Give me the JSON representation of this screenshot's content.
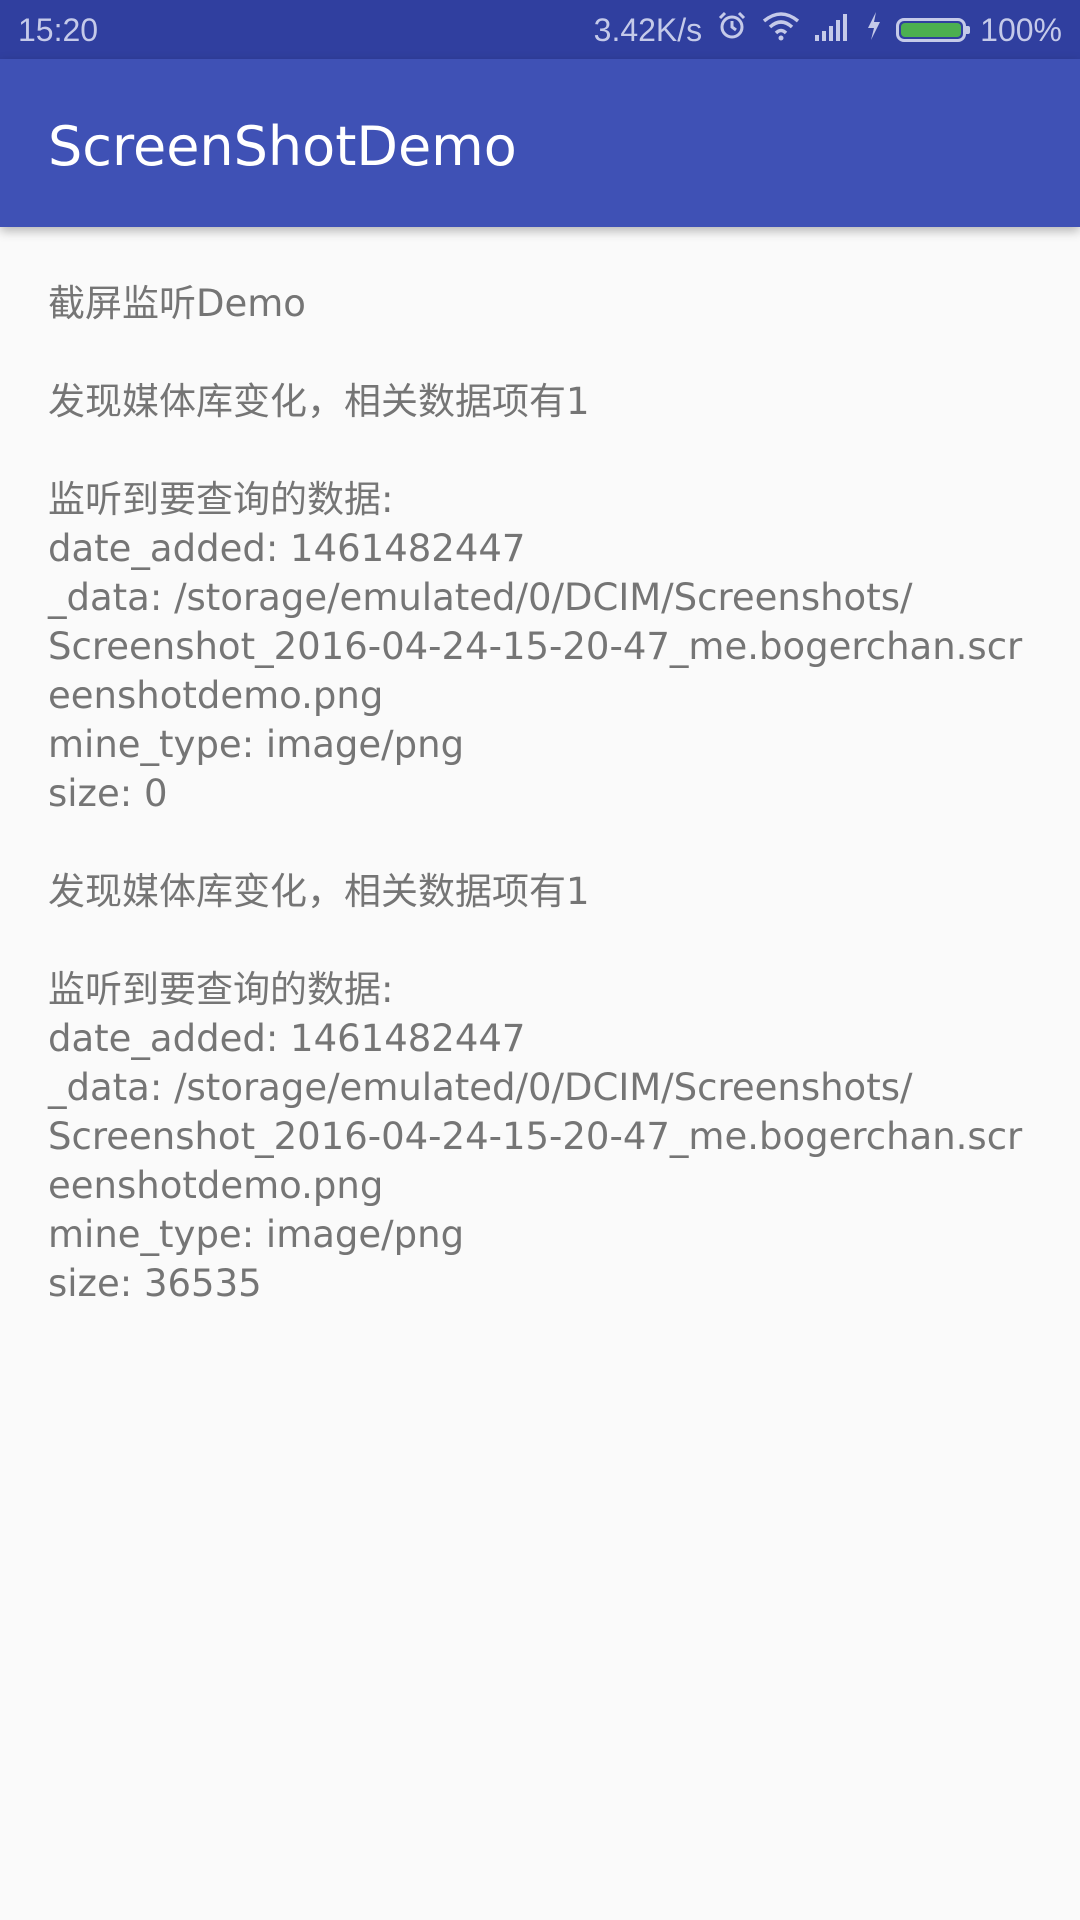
{
  "status_bar": {
    "time": "15:20",
    "network_speed": "3.42K/s",
    "battery_percent": "100%",
    "battery_level": 1.0,
    "icons": [
      "alarm-icon",
      "wifi-icon",
      "signal-icon",
      "charging-icon",
      "battery-icon"
    ],
    "colors": {
      "background": "#303f9f",
      "battery_fill": "#4caf50"
    }
  },
  "app_bar": {
    "title": "ScreenShotDemo",
    "color": "#3f51b5"
  },
  "content": {
    "lines": [
      "截屏监听Demo",
      "",
      "发现媒体库变化，相关数据项有1",
      "",
      "监听到要查询的数据:",
      "date_added: 1461482447",
      "_data: /storage/emulated/0/DCIM/Screenshots/",
      "Screenshot_2016-04-24-15-20-47_me.bogerchan.scr",
      "eenshotdemo.png",
      "mine_type: image/png",
      "size: 0",
      "",
      "发现媒体库变化，相关数据项有1",
      "",
      "监听到要查询的数据:",
      "date_added: 1461482447",
      "_data: /storage/emulated/0/DCIM/Screenshots/",
      "Screenshot_2016-04-24-15-20-47_me.bogerchan.scr",
      "eenshotdemo.png",
      "mine_type: image/png",
      "size: 36535"
    ]
  }
}
